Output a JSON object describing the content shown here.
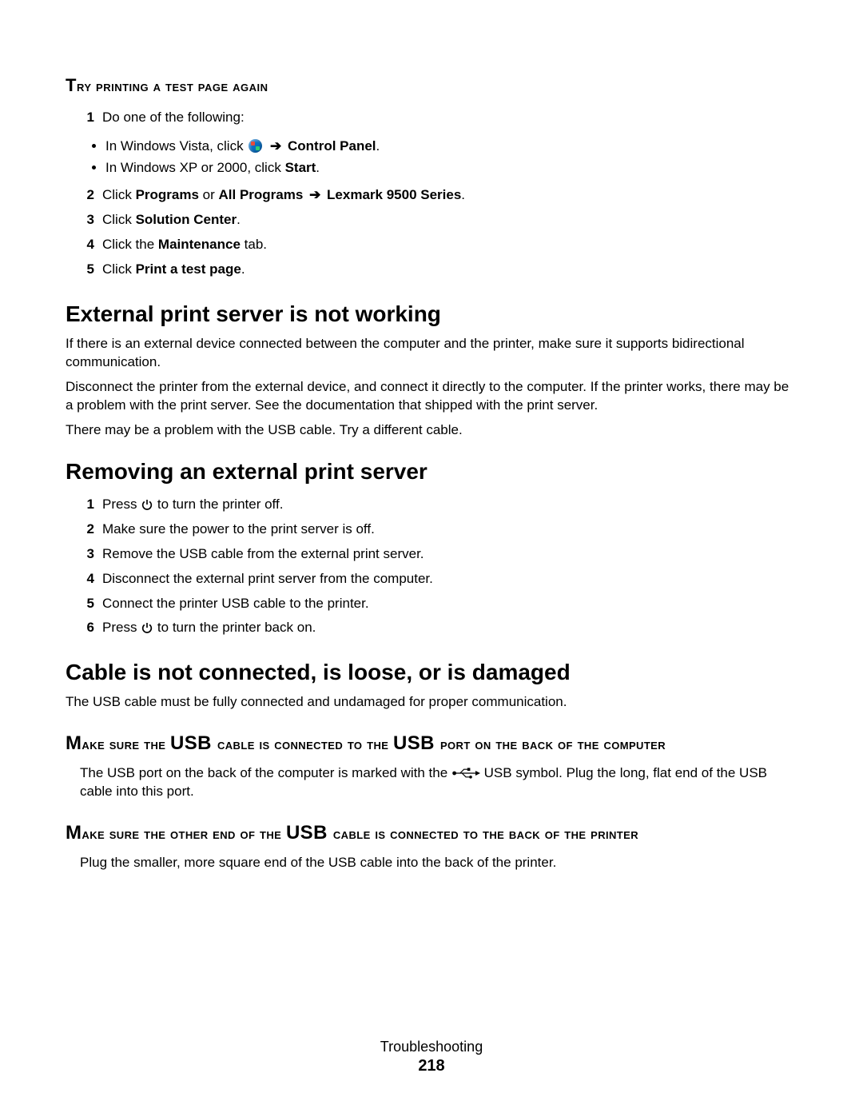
{
  "section1": {
    "heading": "Try printing a test page again",
    "step1_num": "1",
    "step1_text": "Do one of the following:",
    "bullet1_pre": "In Windows Vista, click ",
    "bullet1_post": " Control Panel",
    "bullet2_pre": "In Windows XP or 2000, click ",
    "bullet2_bold": "Start",
    "step2_num": "2",
    "step2_pre": "Click ",
    "step2_b1": "Programs",
    "step2_mid": " or ",
    "step2_b2": "All Programs",
    "step2_post": "Lexmark 9500 Series",
    "step3_num": "3",
    "step3_pre": "Click ",
    "step3_b": "Solution Center",
    "step4_num": "4",
    "step4_pre": "Click the ",
    "step4_b": "Maintenance",
    "step4_post": " tab.",
    "step5_num": "5",
    "step5_pre": "Click ",
    "step5_b": "Print a test page"
  },
  "section2": {
    "heading": "External print server is not working",
    "p1": "If there is an external device connected between the computer and the printer, make sure it supports bidirectional communication.",
    "p2": "Disconnect the printer from the external device, and connect it directly to the computer. If the printer works, there may be a problem with the print server. See the documentation that shipped with the print server.",
    "p3": "There may be a problem with the USB cable. Try a different cable."
  },
  "section3": {
    "heading": "Removing an external print server",
    "s1_num": "1",
    "s1_pre": "Press ",
    "s1_post": " to turn the printer off.",
    "s2_num": "2",
    "s2": "Make sure the power to the print server is off.",
    "s3_num": "3",
    "s3": "Remove the USB cable from the external print server.",
    "s4_num": "4",
    "s4": "Disconnect the external print server from the computer.",
    "s5_num": "5",
    "s5": "Connect the printer USB cable to the printer.",
    "s6_num": "6",
    "s6_pre": "Press ",
    "s6_post": " to turn the printer back on."
  },
  "section4": {
    "heading": "Cable is not connected, is loose, or is damaged",
    "p1": "The USB cable must be fully connected and undamaged for proper communication.",
    "sub1_heading": "Make sure the USB cable is connected to the USB port on the back of the computer",
    "sub1_p_pre": "The USB port on the back of the computer is marked with the ",
    "sub1_p_post": " USB symbol. Plug the long, flat end of the USB cable into this port.",
    "sub2_heading": "Make sure the other end of the USB cable is connected to the back of the printer",
    "sub2_p": "Plug the smaller, more square end of the USB cable into the back of the printer."
  },
  "footer": {
    "label": "Troubleshooting",
    "page": "218"
  },
  "glyphs": {
    "arrow": "➔",
    "dot": "."
  }
}
